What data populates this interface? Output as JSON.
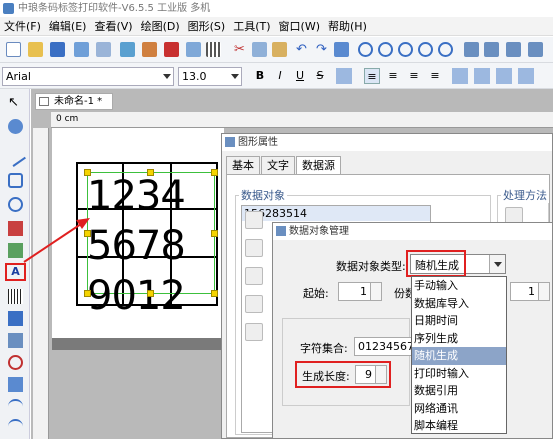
{
  "title": "中琅条码标签打印软件-V6.5.5 工业版 多机",
  "menu": [
    "文件(F)",
    "编辑(E)",
    "查看(V)",
    "绘图(D)",
    "图形(S)",
    "工具(T)",
    "窗口(W)",
    "帮助(H)"
  ],
  "font": {
    "family": "Arial",
    "size": "13.0"
  },
  "format_buttons": [
    "B",
    "I",
    "U",
    "S"
  ],
  "doc_tab": "未命名-1 *",
  "ruler_unit": "0 cm",
  "canvas_text": [
    "1234",
    "5678",
    "9012"
  ],
  "props_dialog": {
    "title": "图形属性",
    "tabs": [
      "基本",
      "文字",
      "数据源"
    ],
    "data_object_label": "数据对象",
    "data_object_value": "156283514",
    "process_label": "处理方法"
  },
  "mgr_dialog": {
    "title": "数据对象管理",
    "type_label": "数据对象类型:",
    "type_value": "随机生成",
    "start_label": "起始:",
    "start_value": "1",
    "copies_label": "份数",
    "copies_value": "1",
    "charset_label": "字符集合:",
    "charset_value": "012345678",
    "length_label": "生成长度:",
    "length_value": "9"
  },
  "dropdown_options": [
    "手动输入",
    "数据库导入",
    "日期时间",
    "序列生成",
    "随机生成",
    "打印时输入",
    "数据引用",
    "网络通讯",
    "脚本编程"
  ],
  "dropdown_selected_index": 4,
  "colors": {
    "annotation": "#e02020",
    "selection": "#3cc03c",
    "highlight": "#8ca4c8"
  }
}
